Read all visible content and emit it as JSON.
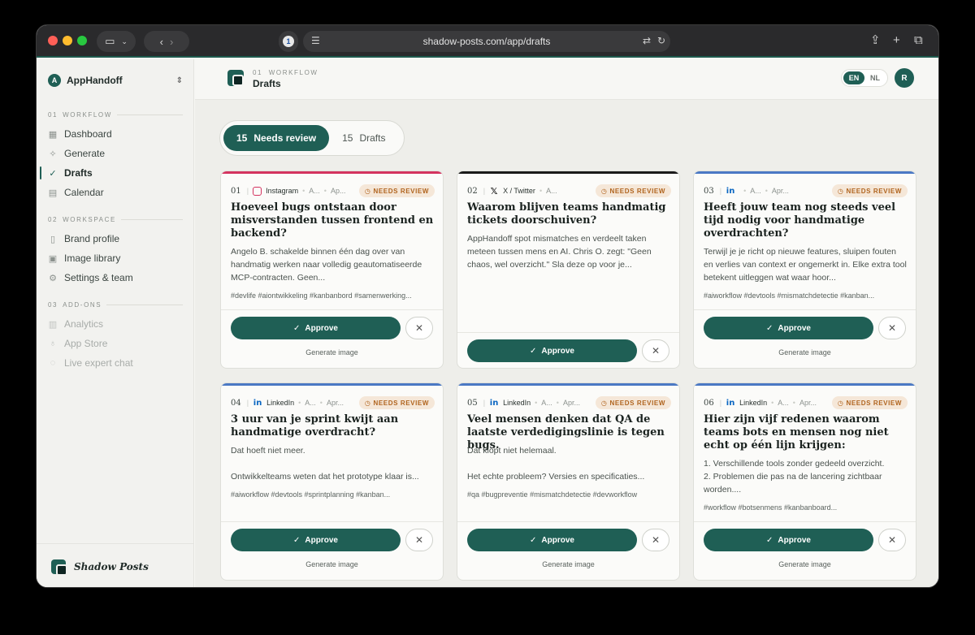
{
  "browser": {
    "url": "shadow-posts.com/app/drafts"
  },
  "sidebar": {
    "workspace_initial": "A",
    "workspace_name": "AppHandoff",
    "sections": [
      {
        "num": "01",
        "title": "WORKFLOW"
      },
      {
        "num": "02",
        "title": "WORKSPACE"
      },
      {
        "num": "03",
        "title": "ADD-ONS"
      }
    ],
    "items": [
      {
        "label": "Dashboard",
        "icon": "grid-icon"
      },
      {
        "label": "Generate",
        "icon": "sparkle-icon"
      },
      {
        "label": "Drafts",
        "icon": "check-circle-icon"
      },
      {
        "label": "Calendar",
        "icon": "calendar-icon"
      },
      {
        "label": "Brand profile",
        "icon": "document-icon"
      },
      {
        "label": "Image library",
        "icon": "image-icon"
      },
      {
        "label": "Settings & team",
        "icon": "gear-icon"
      },
      {
        "label": "Analytics",
        "icon": "chart-icon"
      },
      {
        "label": "App Store",
        "icon": "lightbulb-icon"
      },
      {
        "label": "Live expert chat",
        "icon": "chat-icon"
      }
    ],
    "brand": "Shadow Posts"
  },
  "header": {
    "crumb_num": "01",
    "crumb_section": "WORKFLOW",
    "title": "Drafts",
    "lang_en": "EN",
    "lang_nl": "NL",
    "user_initial": "R"
  },
  "tabs": [
    {
      "count": "15",
      "label": "Needs review"
    },
    {
      "count": "15",
      "label": "Drafts"
    }
  ],
  "colors": {
    "accent": "#1f5f55",
    "instagram_line": "#d4335f",
    "x_line": "#1a1a1a",
    "linkedin_line": "#4a78c4",
    "badge_bg": "#f5e7d8",
    "badge_text": "#b0641e"
  },
  "cards": [
    {
      "idx": "01",
      "platform": "Instagram",
      "platform_icon": "instagram-icon",
      "meta_a": "A...",
      "meta_b": "Ap...",
      "badge": "NEEDS REVIEW",
      "title": "Hoeveel bugs ontstaan door misverstanden tussen frontend en backend?",
      "body": "Angelo B. schakelde binnen één dag over van handmatig werken naar volledig geautomatiseerde MCP-contracten. Geen...",
      "tags": "#devlife #aiontwikkeling #kanbanbord #samenwerking...",
      "approve": "Approve",
      "generate": "Generate image"
    },
    {
      "idx": "02",
      "platform": "X / Twitter",
      "platform_icon": "x-icon",
      "meta_a": "A...",
      "meta_b": "",
      "badge": "NEEDS REVIEW",
      "title": "Waarom blijven teams handmatig tickets doorschuiven?",
      "body": "AppHandoff spot mismatches en verdeelt taken meteen tussen mens en AI. Chris O. zegt: \"Geen chaos, wel overzicht.\" Sla deze op voor je...",
      "tags": "",
      "approve": "Approve",
      "generate": ""
    },
    {
      "idx": "03",
      "platform": "",
      "platform_icon": "linkedin-icon",
      "meta_a": "A...",
      "meta_b": "Apr...",
      "badge": "NEEDS REVIEW",
      "title": "Heeft jouw team nog steeds veel tijd nodig voor handmatige overdrachten?",
      "body": "Terwijl je je richt op nieuwe features, sluipen fouten en verlies van context er ongemerkt in. Elke extra tool betekent uitleggen wat waar hoor...",
      "tags": "#aiworkflow #devtools #mismatchdetectie #kanban...",
      "approve": "Approve",
      "generate": "Generate image"
    },
    {
      "idx": "04",
      "platform": "LinkedIn",
      "platform_icon": "linkedin-icon",
      "meta_a": "A...",
      "meta_b": "Apr...",
      "badge": "NEEDS REVIEW",
      "title": "3 uur van je sprint kwijt aan handmatige overdracht?",
      "body": "Dat hoeft niet meer.\n\nOntwikkelteams weten dat het prototype klaar is...",
      "tags": "#aiworkflow #devtools #sprintplanning #kanban...",
      "approve": "Approve",
      "generate": "Generate image"
    },
    {
      "idx": "05",
      "platform": "LinkedIn",
      "platform_icon": "linkedin-icon",
      "meta_a": "A...",
      "meta_b": "Apr...",
      "badge": "NEEDS REVIEW",
      "title": "Veel mensen denken dat QA de laatste verdedigingslinie is tegen bugs.",
      "body": "Dat klopt niet helemaal.\n\nHet echte probleem? Versies en specificaties...",
      "tags": "#qa #bugpreventie #mismatchdetectie #devworkflow",
      "approve": "Approve",
      "generate": "Generate image"
    },
    {
      "idx": "06",
      "platform": "LinkedIn",
      "platform_icon": "linkedin-icon",
      "meta_a": "A...",
      "meta_b": "Apr...",
      "badge": "NEEDS REVIEW",
      "title": "Hier zijn vijf redenen waarom teams bots en mensen nog niet echt op één lijn krijgen:",
      "body": "1. Verschillende tools zonder gedeeld overzicht.\n2. Problemen die pas na de lancering zichtbaar worden....",
      "tags": "#workflow #botsenmens #kanbanboard...",
      "approve": "Approve",
      "generate": "Generate image"
    }
  ]
}
